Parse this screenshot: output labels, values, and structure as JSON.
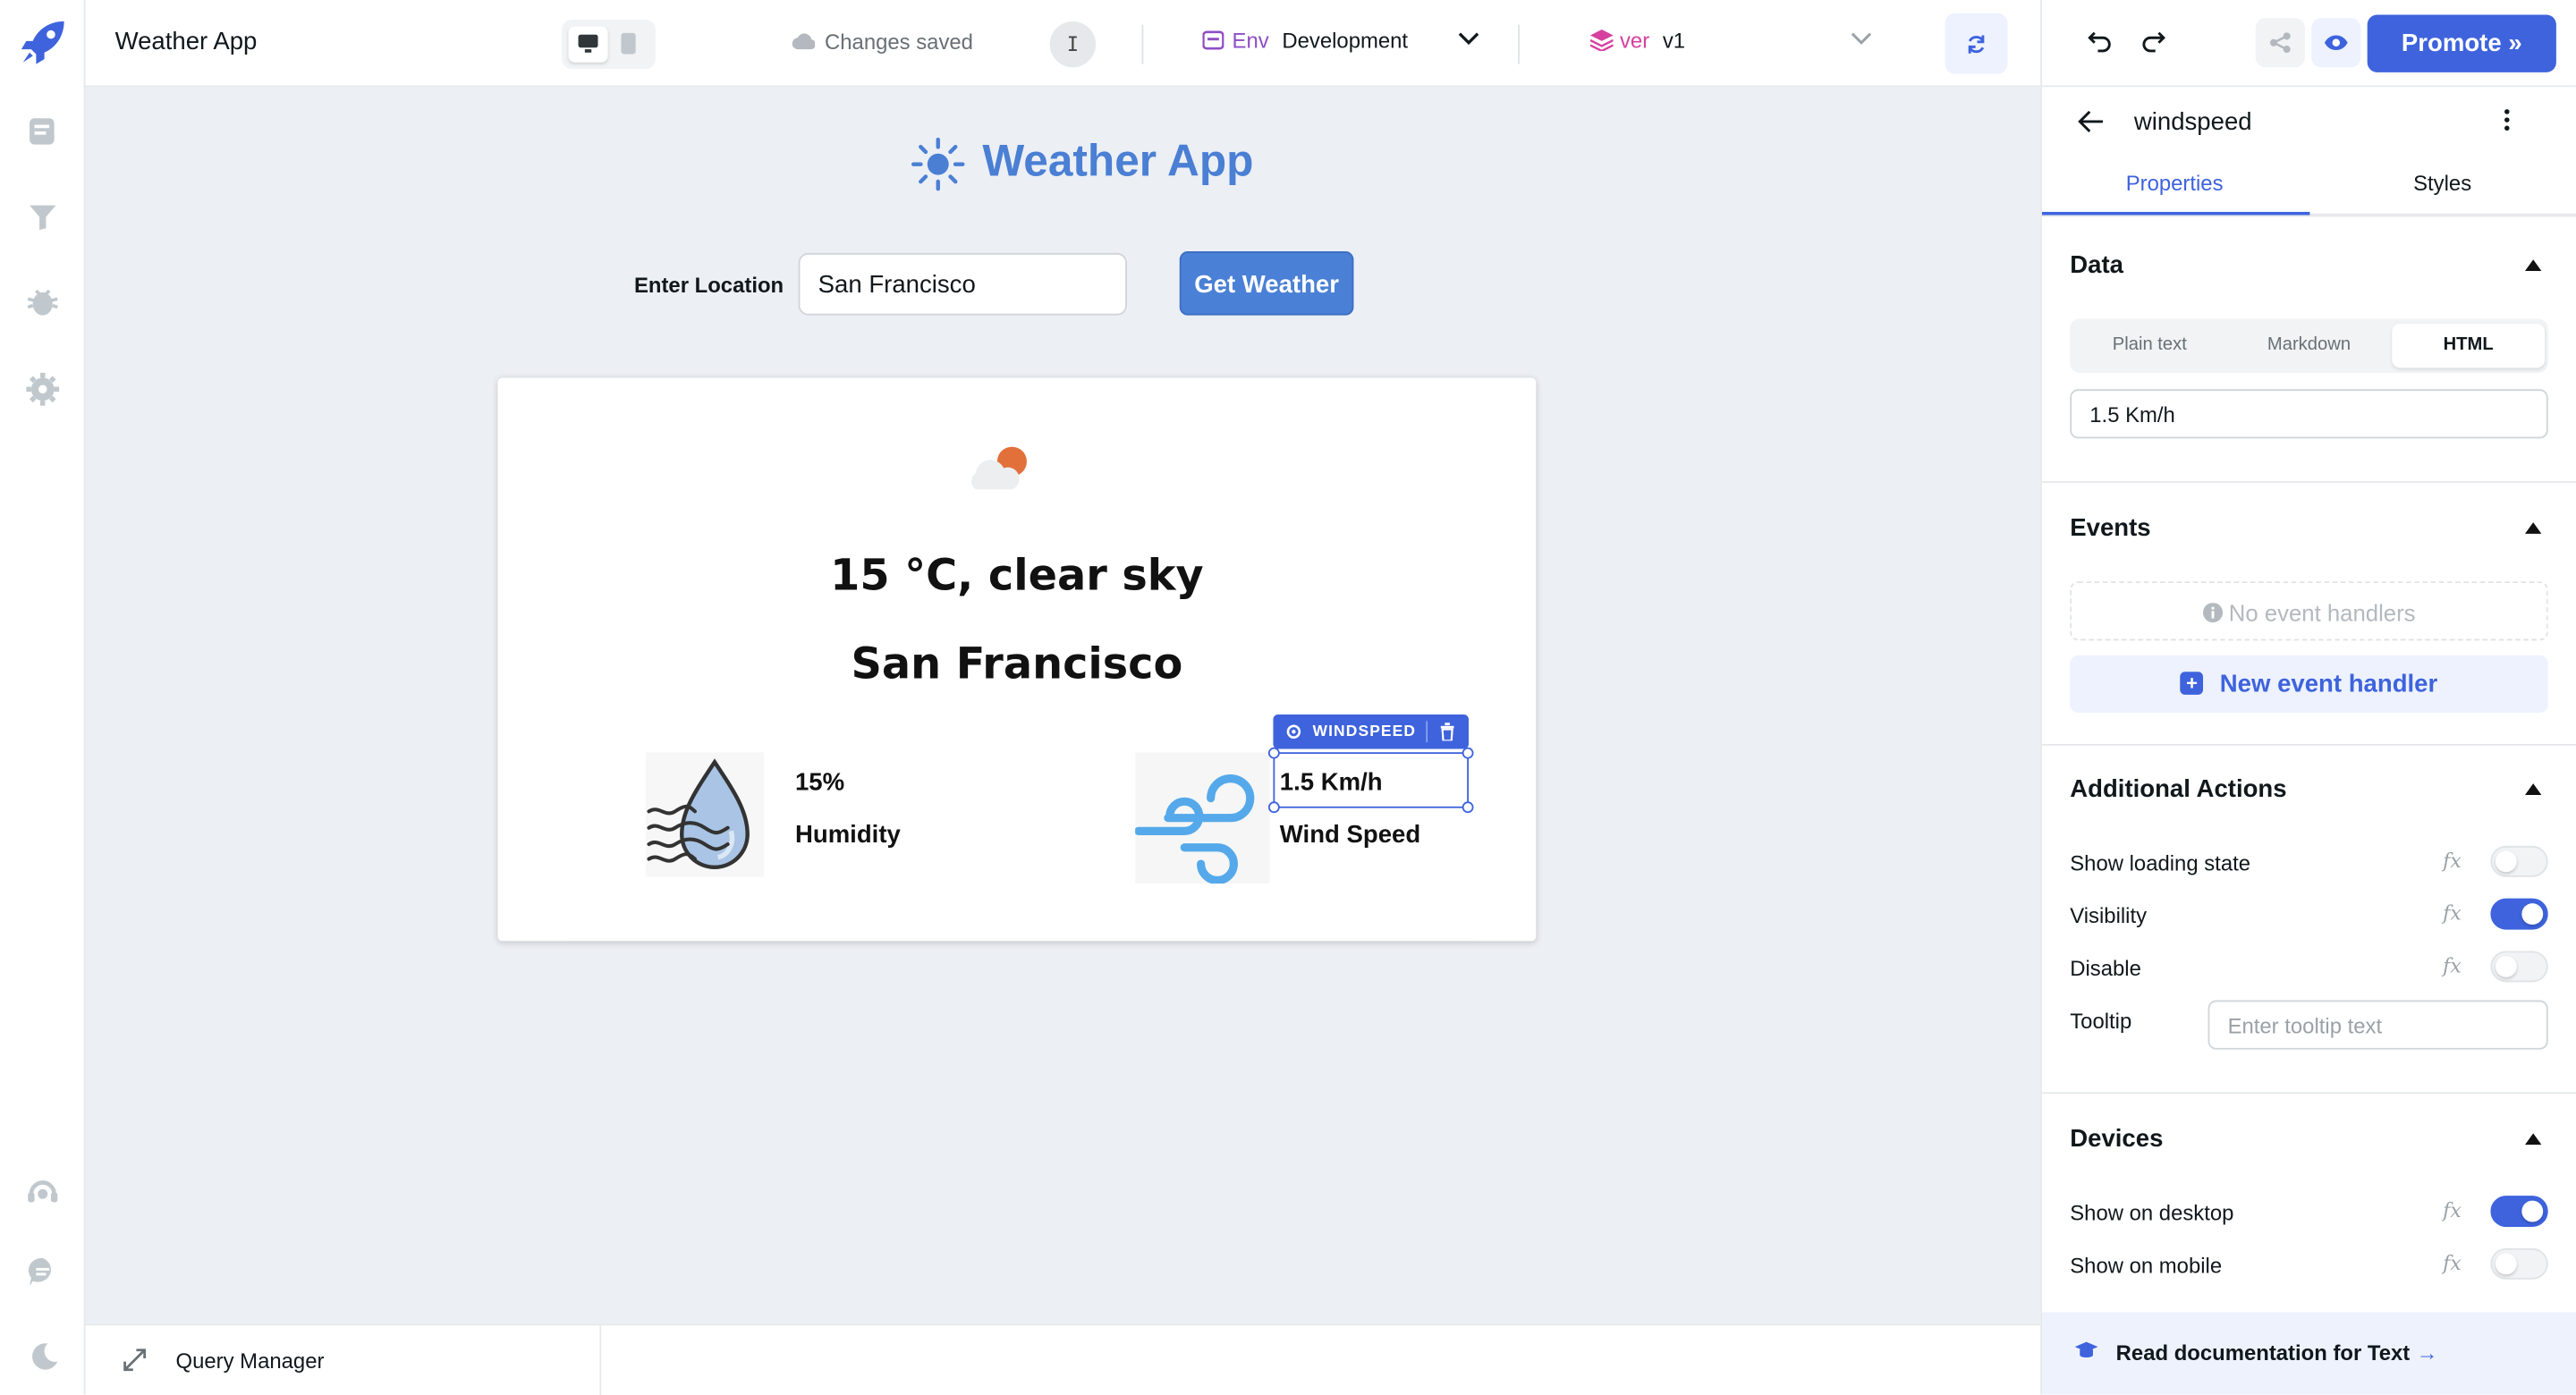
{
  "topbar": {
    "app_name": "Weather App",
    "save_status": "Changes saved",
    "avatar_initial": "I",
    "env_tag": "Env",
    "env_value": "Development",
    "ver_tag": "ver",
    "ver_value": "v1",
    "promote_label": "Promote »"
  },
  "canvas": {
    "title": "Weather App",
    "location_label": "Enter Location",
    "location_value": "San Francisco",
    "get_button": "Get Weather",
    "temperature": "15 °C, clear sky",
    "city": "San Francisco",
    "humidity_value": "15%",
    "humidity_label": "Humidity",
    "windspeed_value": "1.5 Km/h",
    "windspeed_label": "Wind Speed",
    "selected_tag": "WINDSPEED"
  },
  "query_manager": {
    "label": "Query Manager"
  },
  "inspector": {
    "component_name": "windspeed",
    "tabs": [
      "Properties",
      "Styles"
    ],
    "data_title": "Data",
    "format_options": [
      "Plain text",
      "Markdown",
      "HTML"
    ],
    "selected_format": "HTML",
    "text_value": "1.5 Km/h",
    "events_title": "Events",
    "no_events": "No event handlers",
    "new_event": "New event handler",
    "actions_title": "Additional Actions",
    "actions": [
      {
        "label": "Show loading state",
        "on": false
      },
      {
        "label": "Visibility",
        "on": true
      },
      {
        "label": "Disable",
        "on": false
      }
    ],
    "fx_label": "fx",
    "tooltip_label": "Tooltip",
    "tooltip_placeholder": "Enter tooltip text",
    "devices_title": "Devices",
    "devices": [
      {
        "label": "Show on desktop",
        "on": true
      },
      {
        "label": "Show on mobile",
        "on": false
      }
    ],
    "docs_link": "Read documentation for Text",
    "docs_arrow": "→"
  },
  "colors": {
    "accent": "#3e63dd",
    "title_blue": "#4a7fd4",
    "canvas_bg": "#eceff4"
  },
  "icons": [
    "rocket-logo-icon",
    "pages-icon",
    "queries-icon",
    "debugger-icon",
    "settings-icon",
    "support-icon",
    "chat-icon",
    "theme-icon",
    "sun-icon",
    "cloud-sun-icon",
    "humidity-drop-icon",
    "wind-icon",
    "undo-icon",
    "redo-icon",
    "share-icon",
    "eye-icon",
    "back-arrow-icon",
    "more-vert-icon",
    "expand-icon",
    "docs-icon"
  ]
}
